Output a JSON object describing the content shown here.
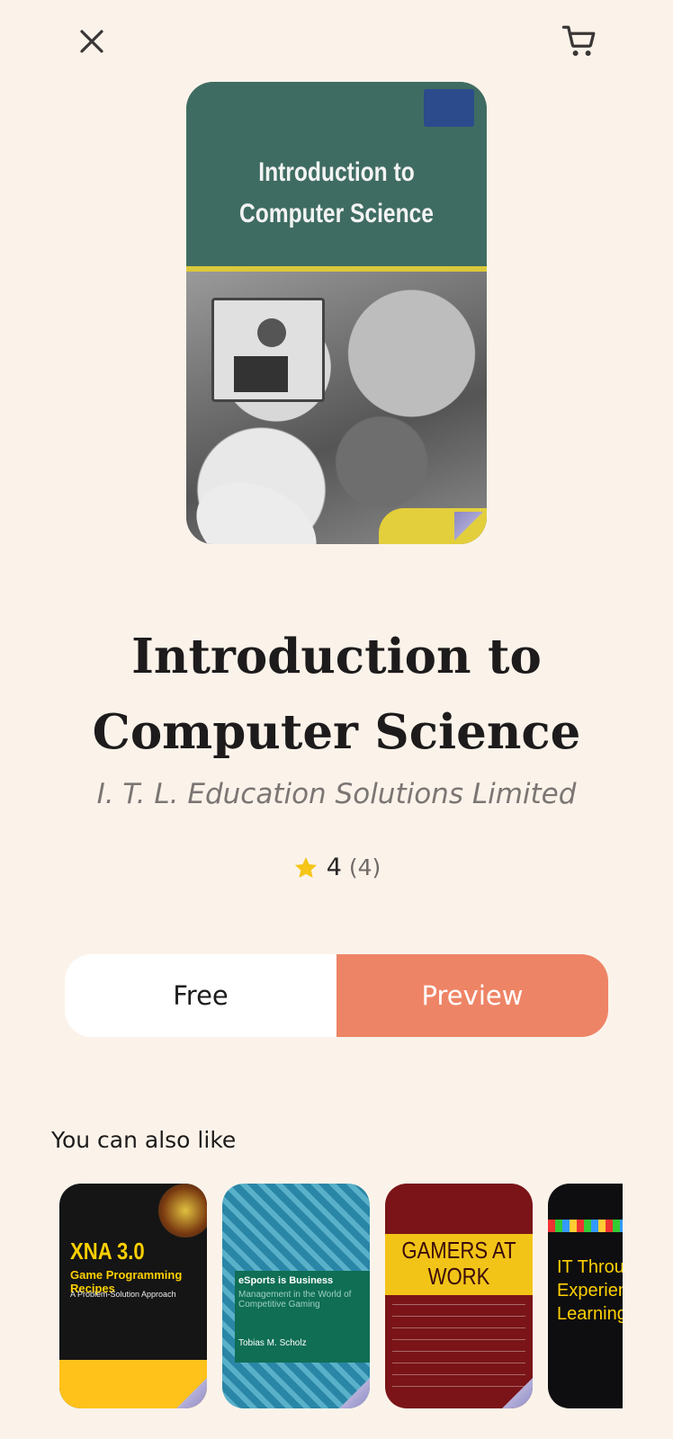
{
  "header": {
    "close_icon": "close-icon",
    "cart_icon": "shopping-cart-icon"
  },
  "book": {
    "cover_title": "Introduction to Computer Science",
    "title_line1": "Introduction to",
    "title_line2": "Computer Science",
    "author": "I. T. L. Education Solutions Limited",
    "rating": "4",
    "rating_count": "(4)",
    "star_color": "#f5c518"
  },
  "actions": {
    "free_label": "Free",
    "preview_label": "Preview",
    "accent_color": "#ee8466"
  },
  "recommendations": {
    "section_title": "You can also like",
    "items": [
      {
        "title": "XNA 3.0",
        "subtitle": "Game Programming Recipes",
        "tagline": "A Problem-Solution Approach"
      },
      {
        "title": "eSports is Business",
        "subtitle": "Management in the World of Competitive Gaming",
        "author": "Tobias M. Scholz"
      },
      {
        "title": "GAMERS AT WORK"
      },
      {
        "title": "IT Through Experiential Learning"
      }
    ]
  }
}
